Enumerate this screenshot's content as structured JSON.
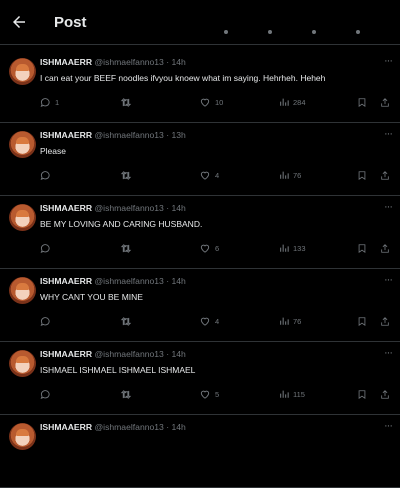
{
  "header": {
    "title": "Post"
  },
  "posts": [
    {
      "name": "ISHMAAERR",
      "handle": "@ishmaelfanno13 · 14h",
      "text": "I can eat your BEEF noodles ifvyou knoew what im saying. Hehrheh. Heheh",
      "replies": "1",
      "reposts": "",
      "likes": "10",
      "views": "284"
    },
    {
      "name": "ISHMAAERR",
      "handle": "@ishmaelfanno13 · 13h",
      "text": "Please",
      "replies": "",
      "reposts": "",
      "likes": "4",
      "views": "76"
    },
    {
      "name": "ISHMAAERR",
      "handle": "@ishmaelfanno13 · 14h",
      "text": "BE MY LOVING AND CARING HUSBAND.",
      "replies": "",
      "reposts": "",
      "likes": "6",
      "views": "133"
    },
    {
      "name": "ISHMAAERR",
      "handle": "@ishmaelfanno13 · 14h",
      "text": "WHY CANT YOU BE MINE",
      "replies": "",
      "reposts": "",
      "likes": "4",
      "views": "76"
    },
    {
      "name": "ISHMAAERR",
      "handle": "@ishmaelfanno13 · 14h",
      "text": "ISHMAEL ISHMAEL ISHMAEL ISHMAEL",
      "replies": "",
      "reposts": "",
      "likes": "5",
      "views": "115"
    },
    {
      "name": "ISHMAAERR",
      "handle": "@ishmaelfanno13 · 14h",
      "text": "",
      "replies": "",
      "reposts": "",
      "likes": "",
      "views": ""
    }
  ],
  "colors": {
    "background": "#000000",
    "text": "#e7e9ea",
    "muted": "#71767b",
    "divider": "#2f3336"
  },
  "icons": [
    "back-arrow-icon",
    "reply-icon",
    "repost-icon",
    "like-icon",
    "views-icon",
    "bookmark-icon",
    "share-icon",
    "more-icon"
  ]
}
